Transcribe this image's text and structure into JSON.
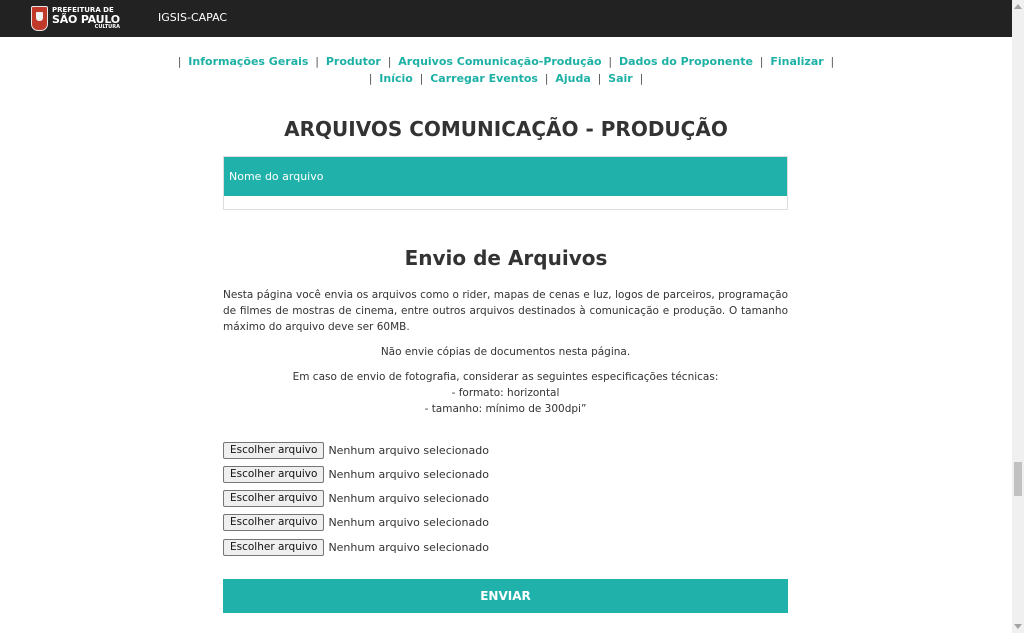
{
  "header": {
    "logo": {
      "line1": "PREFEITURA DE",
      "line2": "SÃO PAULO",
      "line3": "CULTURA"
    },
    "app_title": "IGSIS-CAPAC"
  },
  "nav": {
    "row1": [
      "Informações Gerais",
      "Produtor",
      "Arquivos Comunicação-Produção",
      "Dados do Proponente",
      "Finalizar"
    ],
    "row2": [
      "Início",
      "Carregar Eventos",
      "Ajuda",
      "Sair"
    ],
    "separator": "|"
  },
  "page_title": "ARQUIVOS COMUNICAÇÃO - PRODUÇÃO",
  "files_table": {
    "header": "Nome do arquivo"
  },
  "upload": {
    "title": "Envio de Arquivos",
    "description": "Nesta página você envia os arquivos como o rider, mapas de cenas e luz, logos de parceiros, programação de filmes de mostras de cinema, entre outros arquivos destinados à comunicação e produção. O tamanho máximo do arquivo deve ser 60MB.",
    "no_copies": "Não envie cópias de documentos nesta página.",
    "photo_spec": [
      "Em caso de envio de fotografia, considerar as seguintes especificações técnicas:",
      "- formato: horizontal",
      "- tamanho: mínimo de 300dpi”"
    ],
    "file_button_label": "Escolher arquivo",
    "file_status": "Nenhum arquivo selecionado",
    "submit_label": "ENVIAR"
  },
  "colors": {
    "accent": "#20b2aa",
    "link": "#1db0a5",
    "topbar": "#222222"
  }
}
